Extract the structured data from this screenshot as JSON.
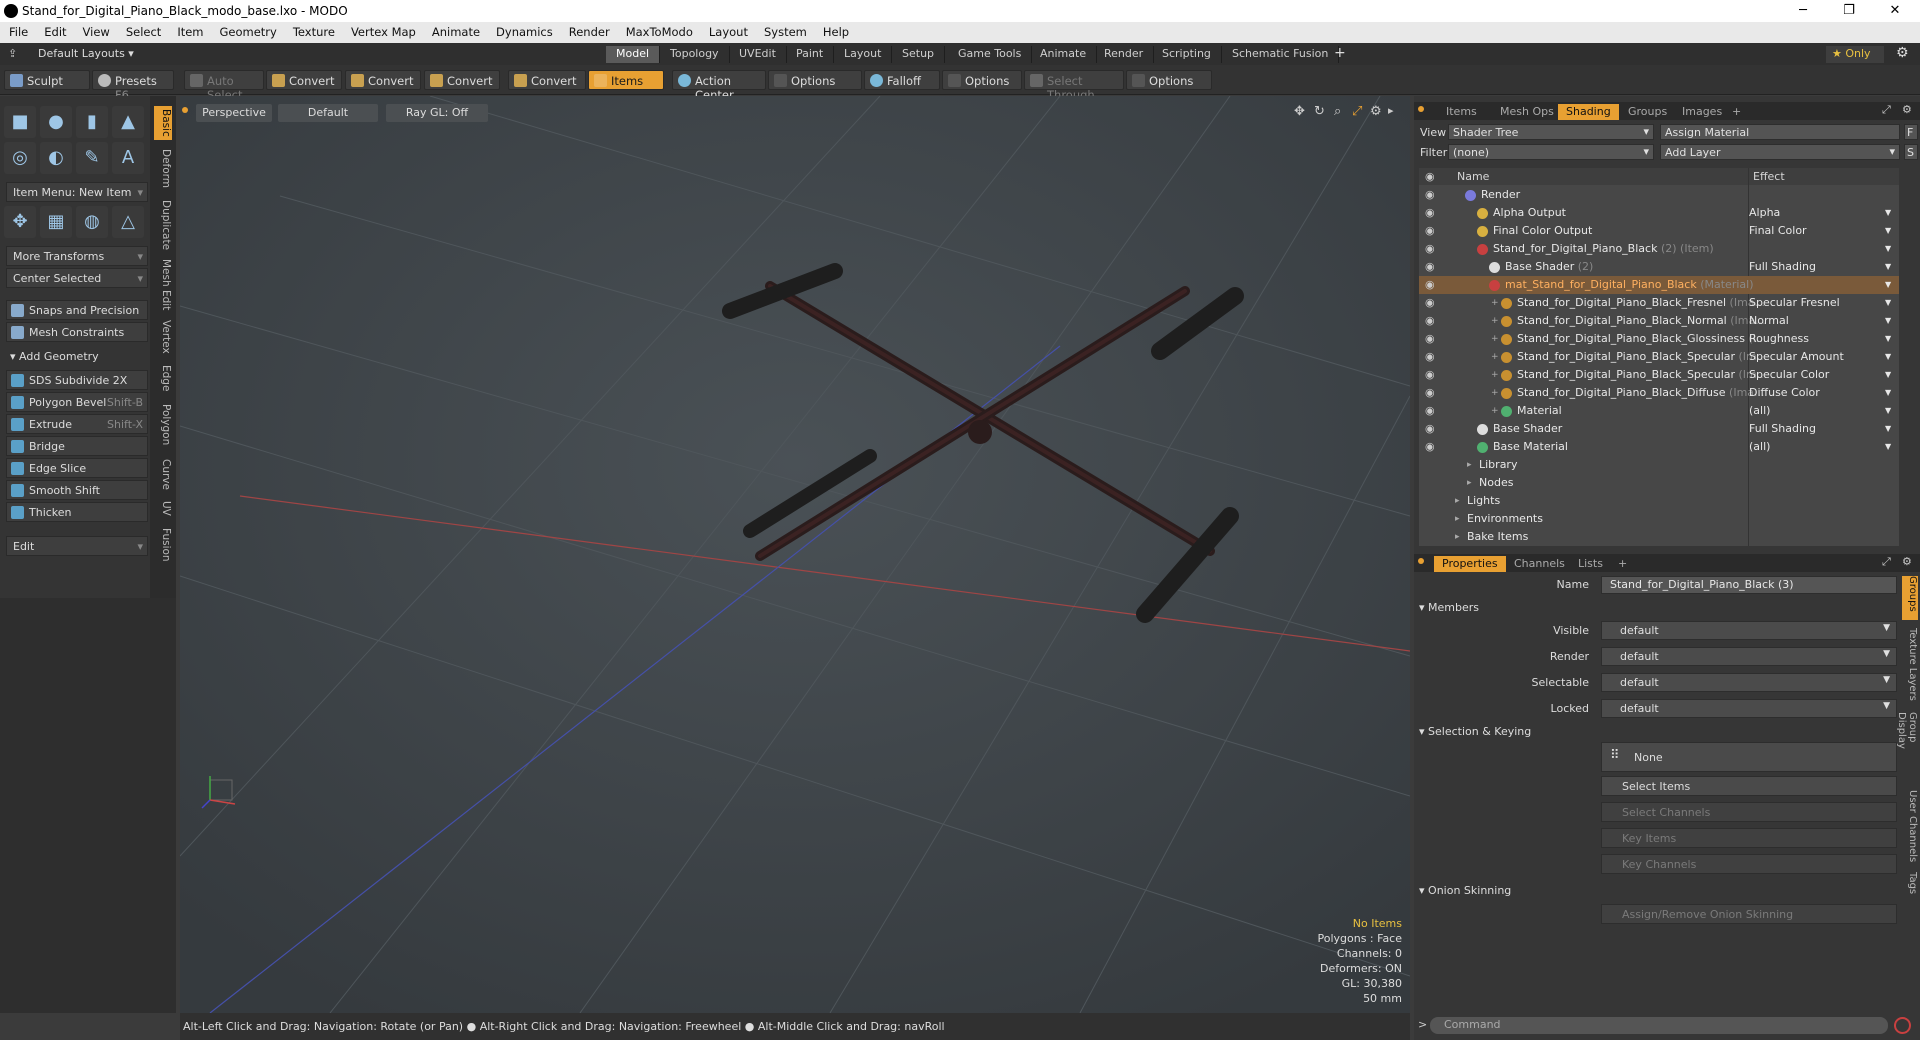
{
  "window": {
    "title": "Stand_for_Digital_Piano_Black_modo_base.lxo - MODO",
    "minimize": "─",
    "maximize": "❐",
    "close": "✕"
  },
  "menu": [
    "File",
    "Edit",
    "View",
    "Select",
    "Item",
    "Geometry",
    "Texture",
    "Vertex Map",
    "Animate",
    "Dynamics",
    "Render",
    "MaxToModo",
    "Layout",
    "System",
    "Help"
  ],
  "layoutbar": {
    "layouts_label": "Default Layouts ▾",
    "tabs": [
      "Model",
      "Topology",
      "UVEdit",
      "Paint",
      "Layout",
      "Setup",
      "Game Tools",
      "Animate",
      "Render",
      "Scripting",
      "Schematic Fusion"
    ],
    "active_tab": "Model",
    "add": "+",
    "only": "★ Only",
    "gear": "⚙"
  },
  "toolbar": {
    "sculpt": "Sculpt",
    "presets": "Presets",
    "presets_key": "F6",
    "auto_select": "Auto Select",
    "convert1": "Convert",
    "convert2": "Convert",
    "convert3": "Convert",
    "convert4": "Convert",
    "items": "Items",
    "action_center": "Action Center",
    "options1": "Options",
    "falloff": "Falloff",
    "options2": "Options",
    "select_through": "Select Through",
    "options3": "Options"
  },
  "leftpanel": {
    "item_menu": "Item Menu: New Item",
    "more_transforms": "More Transforms",
    "center_selected": "Center Selected",
    "snaps": "Snaps and Precision",
    "mesh_constraints": "Mesh Constraints",
    "add_geometry": "Add Geometry",
    "tools": [
      {
        "label": "SDS Subdivide 2X",
        "key": ""
      },
      {
        "label": "Polygon Bevel",
        "key": "Shift-B"
      },
      {
        "label": "Extrude",
        "key": "Shift-X"
      },
      {
        "label": "Bridge",
        "key": ""
      },
      {
        "label": "Edge Slice",
        "key": ""
      },
      {
        "label": "Smooth Shift",
        "key": ""
      },
      {
        "label": "Thicken",
        "key": ""
      }
    ],
    "edit": "Edit",
    "vtabs": [
      "Basic",
      "Deform",
      "Duplicate",
      "Mesh Edit",
      "Vertex",
      "Edge",
      "Polygon",
      "Curve",
      "UV",
      "Fusion"
    ]
  },
  "viewport": {
    "view": "Perspective",
    "shading": "Default",
    "raygl": "Ray GL: Off",
    "stats": {
      "items": "No Items",
      "polygons": "Polygons : Face",
      "channels": "Channels: 0",
      "deformers": "Deformers: ON",
      "gl": "GL: 30,380",
      "focal": "50 mm"
    }
  },
  "status": "Alt-Left Click and Drag: Navigation: Rotate (or Pan) ● Alt-Right Click and Drag: Navigation: Freewheel ● Alt-Middle Click and Drag: navRoll",
  "rightpanel": {
    "tabs": [
      "Items",
      "Mesh Ops",
      "Shading",
      "Groups",
      "Images"
    ],
    "active_tab": "Shading",
    "view_label": "View",
    "view_value": "Shader Tree",
    "assign_material": "Assign Material",
    "filter_label": "Filter",
    "filter_value": "(none)",
    "add_layer": "Add Layer",
    "f_btn": "F",
    "s_btn": "S",
    "col_name": "Name",
    "col_effect": "Effect",
    "tree": [
      {
        "indent": 0,
        "label": "Render",
        "sub": "",
        "effect": "",
        "color": "#7a7adc",
        "sel": false
      },
      {
        "indent": 1,
        "label": "Alpha Output",
        "sub": "",
        "effect": "Alpha",
        "color": "#d8b040",
        "sel": false
      },
      {
        "indent": 1,
        "label": "Final Color Output",
        "sub": "",
        "effect": "Final Color",
        "color": "#d8b040",
        "sel": false
      },
      {
        "indent": 1,
        "label": "Stand_for_Digital_Piano_Black",
        "sub": " (2) (Item)",
        "effect": "",
        "color": "#c84040",
        "sel": false
      },
      {
        "indent": 2,
        "label": "Base Shader",
        "sub": " (2)",
        "effect": "Full Shading",
        "color": "#dddddd",
        "sel": false
      },
      {
        "indent": 2,
        "label": "mat_Stand_for_Digital_Piano_Black",
        "sub": " (Material)",
        "effect": "",
        "color": "#c84040",
        "sel": true
      },
      {
        "indent": 3,
        "label": "Stand_for_Digital_Piano_Black_Fresnel",
        "sub": " (Ima...",
        "effect": "Specular Fresnel",
        "color": "#c89030",
        "sel": false
      },
      {
        "indent": 3,
        "label": "Stand_for_Digital_Piano_Black_Normal",
        "sub": " (Ima...",
        "effect": "Normal",
        "color": "#c89030",
        "sel": false
      },
      {
        "indent": 3,
        "label": "Stand_for_Digital_Piano_Black_Glossiness",
        "sub": " (I...",
        "effect": "Roughness",
        "color": "#c89030",
        "sel": false
      },
      {
        "indent": 3,
        "label": "Stand_for_Digital_Piano_Black_Specular",
        "sub": " (Im...",
        "effect": "Specular Amount",
        "color": "#c89030",
        "sel": false
      },
      {
        "indent": 3,
        "label": "Stand_for_Digital_Piano_Black_Specular",
        "sub": " (Im...",
        "effect": "Specular Color",
        "color": "#c89030",
        "sel": false
      },
      {
        "indent": 3,
        "label": "Stand_for_Digital_Piano_Black_Diffuse",
        "sub": " (Ima...",
        "effect": "Diffuse Color",
        "color": "#c89030",
        "sel": false
      },
      {
        "indent": 3,
        "label": "Material",
        "sub": "",
        "effect": "(all)",
        "color": "#50b070",
        "sel": false
      },
      {
        "indent": 1,
        "label": "Base Shader",
        "sub": "",
        "effect": "Full Shading",
        "color": "#dddddd",
        "sel": false
      },
      {
        "indent": 1,
        "label": "Base Material",
        "sub": "",
        "effect": "(all)",
        "color": "#50b070",
        "sel": false
      },
      {
        "indent": 1,
        "label": "Library",
        "sub": "",
        "effect": "",
        "color": "",
        "sel": false
      },
      {
        "indent": 1,
        "label": "Nodes",
        "sub": "",
        "effect": "",
        "color": "",
        "sel": false
      },
      {
        "indent": 0,
        "label": "Lights",
        "sub": "",
        "effect": "",
        "color": "",
        "sel": false
      },
      {
        "indent": 0,
        "label": "Environments",
        "sub": "",
        "effect": "",
        "color": "",
        "sel": false
      },
      {
        "indent": 0,
        "label": "Bake Items",
        "sub": "",
        "effect": "",
        "color": "",
        "sel": false
      }
    ],
    "props_tabs": [
      "Properties",
      "Channels",
      "Lists"
    ],
    "props_active": "Properties",
    "name_label": "Name",
    "name_value": "Stand_for_Digital_Piano_Black (3)",
    "members": "Members",
    "visible_label": "Visible",
    "visible": "default",
    "render_label": "Render",
    "render": "default",
    "selectable_label": "Selectable",
    "selectable": "default",
    "locked_label": "Locked",
    "locked": "default",
    "selection_keying": "Selection & Keying",
    "none": "None",
    "select_items": "Select Items",
    "select_channels": "Select Channels",
    "key_items": "Key Items",
    "key_channels": "Key Channels",
    "onion": "Onion Skinning",
    "assign_onion": "Assign/Remove Onion Skinning",
    "rvtabs": [
      "Groups",
      "Texture Layers",
      "Group Display",
      "User Channels",
      "Tags"
    ],
    "command": "Command"
  }
}
